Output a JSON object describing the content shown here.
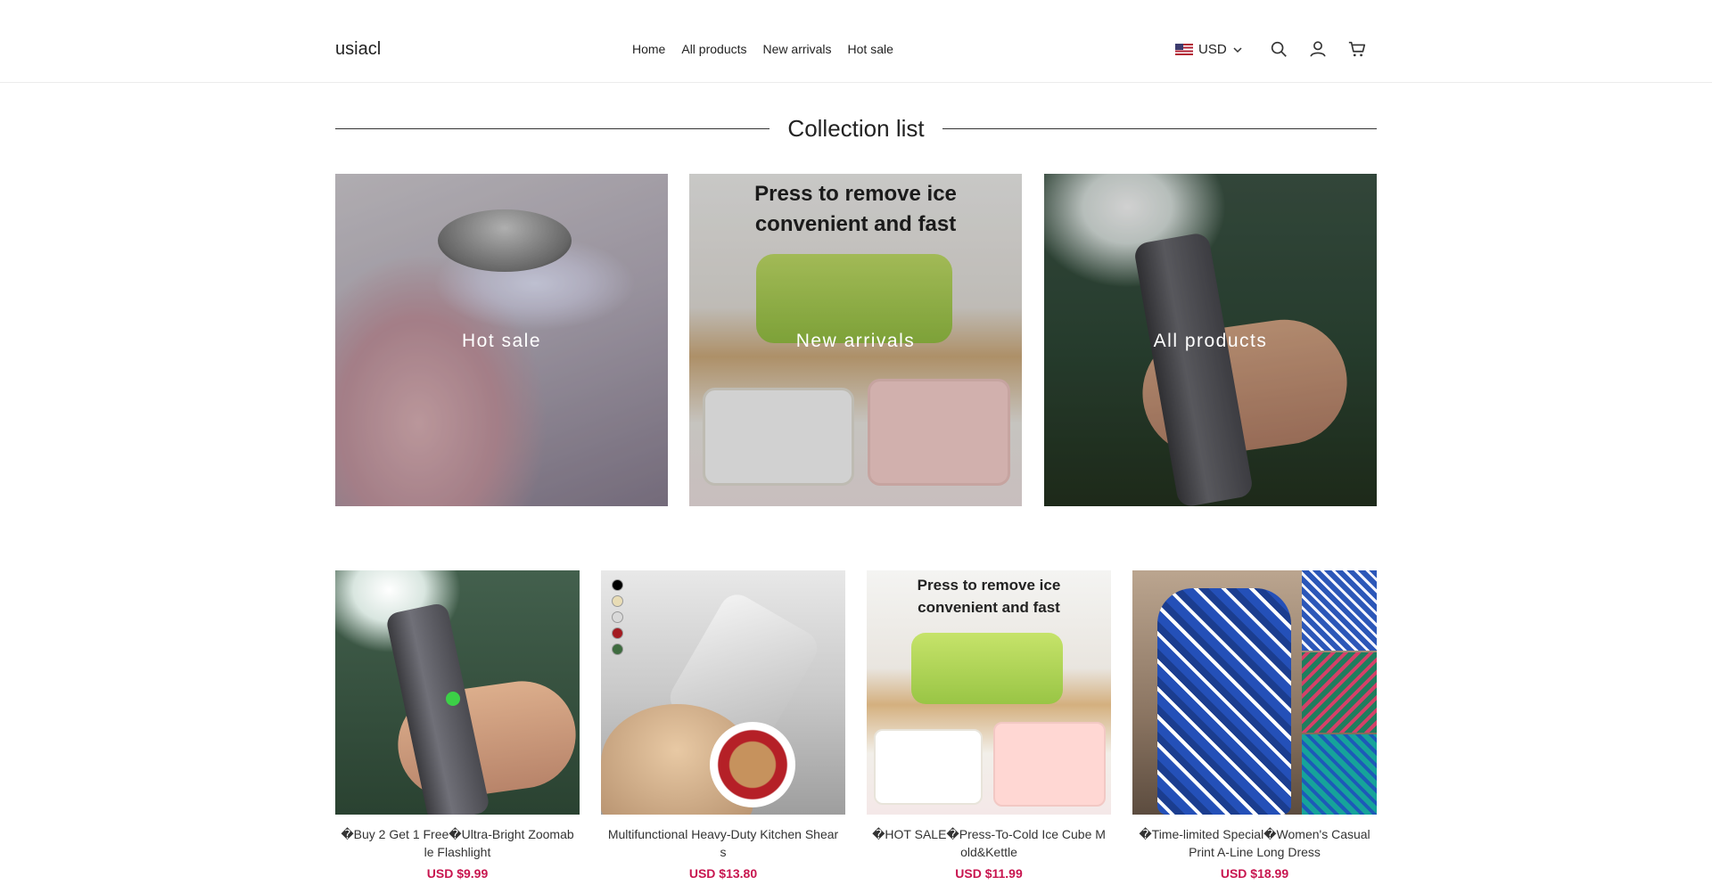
{
  "header": {
    "logo": "usiacl",
    "nav": [
      "Home",
      "All products",
      "New arrivals",
      "Hot sale"
    ],
    "currency": "USD"
  },
  "collection_section": {
    "title": "Collection list",
    "items": [
      {
        "label": "Hot sale"
      },
      {
        "label": "New arrivals",
        "ad_text": [
          "Press to remove ice",
          "convenient and fast"
        ]
      },
      {
        "label": "All products"
      }
    ]
  },
  "products": [
    {
      "name": "�Buy 2 Get 1 Free�Ultra-Bright Zoomable Flashlight",
      "price": "USD $9.99"
    },
    {
      "name": "Multifunctional Heavy-Duty Kitchen Shears",
      "price": "USD $13.80",
      "color_swatches": [
        "#000000",
        "#e8dcb5",
        "#d9d9d9",
        "#a31b21",
        "#3e6b3f"
      ]
    },
    {
      "name": "�HOT SALE�Press-To-Cold Ice Cube Mold&Kettle",
      "price": "USD $11.99",
      "ad_text": [
        "Press to remove ice",
        "convenient and fast"
      ]
    },
    {
      "name": "�Time-limited Special�Women's Casual Print A-Line Long Dress",
      "price": "USD $18.99"
    }
  ],
  "colors": {
    "price": "#c8154f",
    "text": "#222222",
    "border": "#ececec"
  }
}
